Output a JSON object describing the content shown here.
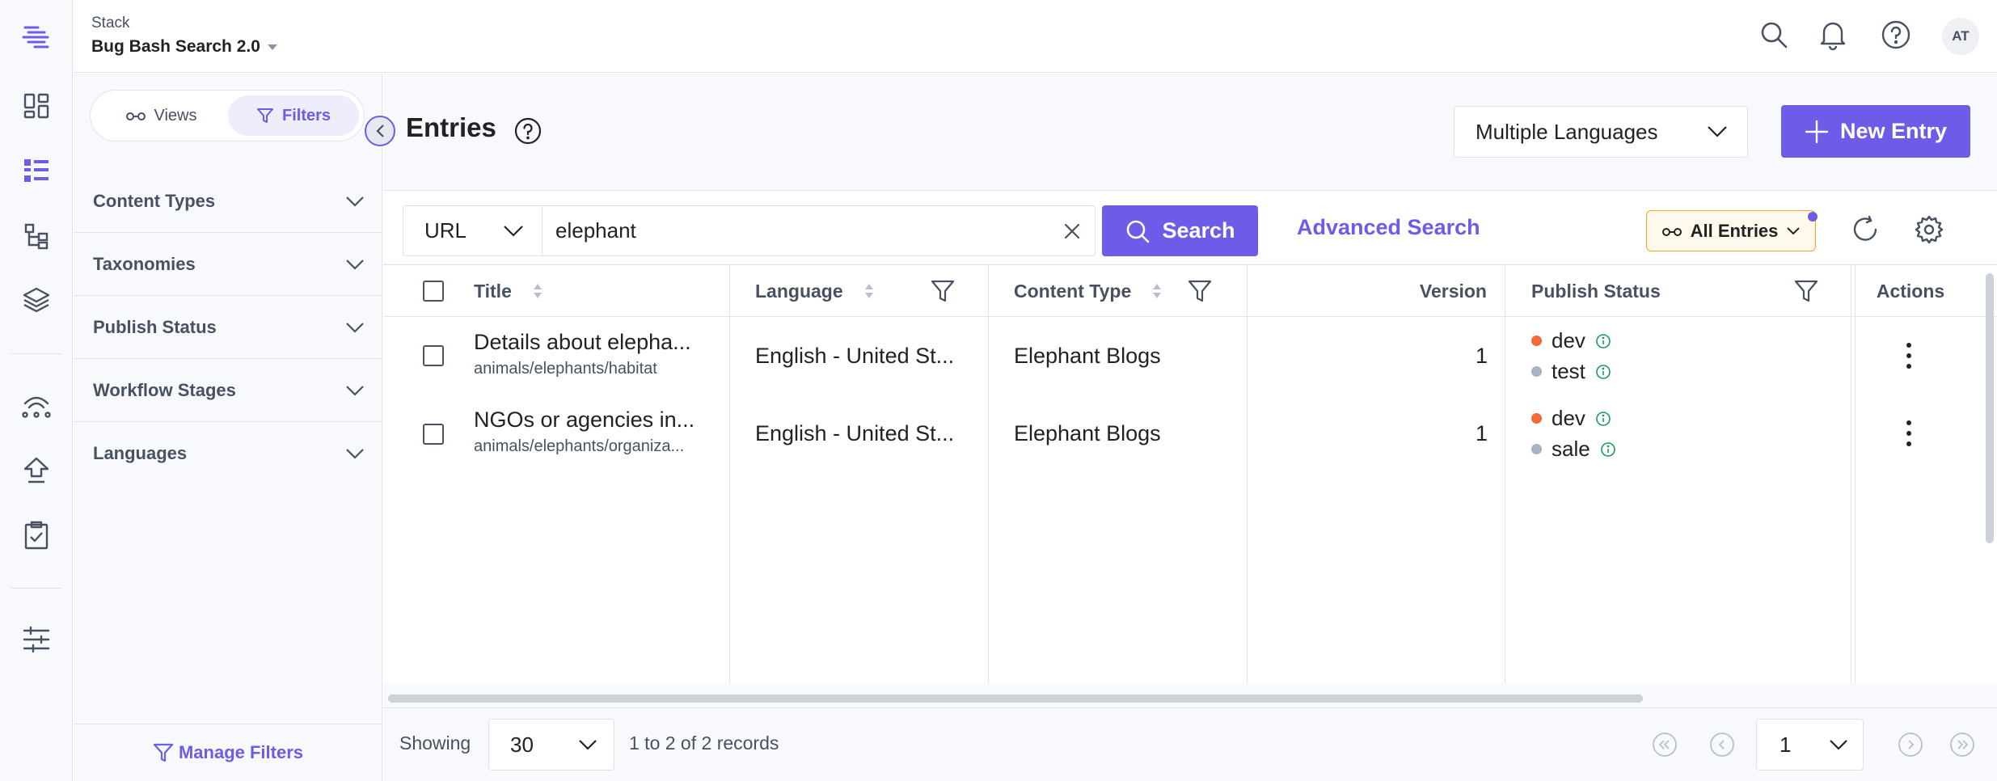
{
  "header": {
    "stack_label": "Stack",
    "stack_name": "Bug Bash Search 2.0",
    "avatar_initials": "AT"
  },
  "rail": {
    "icons": [
      "logo-icon",
      "dashboard-icon",
      "entries-icon",
      "content-models-icon",
      "assets-icon",
      "deployments-icon",
      "publish-queue-icon",
      "tasks-icon",
      "settings-icon"
    ]
  },
  "sidebar": {
    "views_label": "Views",
    "filters_label": "Filters",
    "filters": [
      "Content Types",
      "Taxonomies",
      "Publish Status",
      "Workflow Stages",
      "Languages"
    ],
    "manage_filters_label": "Manage Filters"
  },
  "main": {
    "title": "Entries",
    "language_select": "Multiple Languages",
    "new_entry_label": "New Entry"
  },
  "search": {
    "field_select": "URL",
    "query": "elephant",
    "search_label": "Search",
    "advanced_label": "Advanced Search",
    "view_label": "All Entries"
  },
  "table": {
    "columns": [
      "Title",
      "Language",
      "Content Type",
      "Version",
      "Publish Status",
      "Actions"
    ],
    "rows": [
      {
        "title": "Details about elepha...",
        "url": "animals/elephants/habitat",
        "language": "English - United St...",
        "content_type": "Elephant Blogs",
        "version": "1",
        "statuses": [
          {
            "env": "dev",
            "color": "#f26b38"
          },
          {
            "env": "test",
            "color": "#a9b3c4"
          }
        ]
      },
      {
        "title": "NGOs or agencies in...",
        "url": "animals/elephants/organiza...",
        "language": "English - United St...",
        "content_type": "Elephant Blogs",
        "version": "1",
        "statuses": [
          {
            "env": "dev",
            "color": "#f26b38"
          },
          {
            "env": "sale",
            "color": "#a9b3c4"
          }
        ]
      }
    ]
  },
  "footer": {
    "showing_label": "Showing",
    "per_page": "30",
    "records_text": "1 to 2 of 2 records",
    "current_page": "1"
  },
  "colors": {
    "accent": "#6c5ce7",
    "text": "#222222",
    "muted": "#475161",
    "warning_border": "#f5a524"
  }
}
